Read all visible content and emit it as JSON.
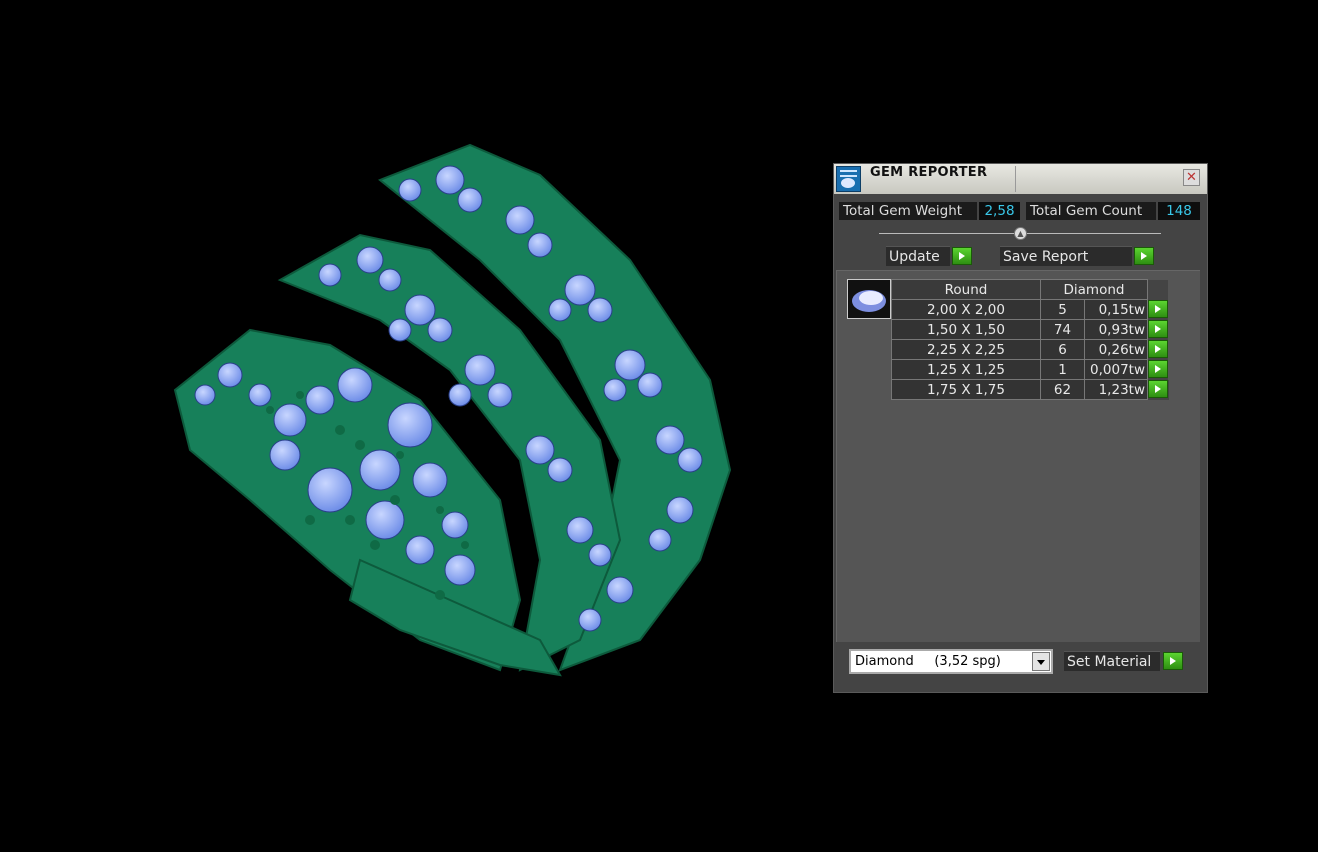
{
  "panel": {
    "title": "GEM REPORTER",
    "close_icon": "close-x-icon",
    "total_weight_label": "Total Gem Weight",
    "total_weight_value": "2,58",
    "total_count_label": "Total Gem Count",
    "total_count_value": "148",
    "update_label": "Update",
    "save_label": "Save Report",
    "table": {
      "header_shape": "Round",
      "header_material": "Diamond",
      "rows": [
        {
          "size": "2,00 X 2,00",
          "count": "5",
          "weight": "0,15tw"
        },
        {
          "size": "1,50 X 1,50",
          "count": "74",
          "weight": "0,93tw"
        },
        {
          "size": "2,25 X 2,25",
          "count": "6",
          "weight": "0,26tw"
        },
        {
          "size": "1,25 X 1,25",
          "count": "1",
          "weight": "0,007tw"
        },
        {
          "size": "1,75 X 1,75",
          "count": "62",
          "weight": "1,23tw"
        }
      ]
    },
    "material_select_value": "Diamond     (3,52 spg)",
    "set_material_label": "Set Material"
  },
  "colors": {
    "metal": "#1a8a5c",
    "gem": "#8fa8f0",
    "value_text": "#39c7e8",
    "play_button": "#3cb01c"
  }
}
